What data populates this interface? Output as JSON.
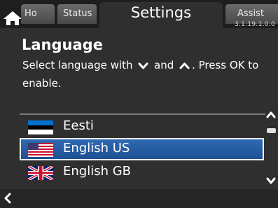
{
  "tabs": {
    "home": {
      "label": "Ho",
      "icon": "home-icon"
    },
    "status": {
      "label": "Status"
    },
    "settings": {
      "label": "Settings"
    },
    "assist": {
      "label": "Assist"
    }
  },
  "version": "3.1.19.1.0.0",
  "page": {
    "heading": "Language",
    "instruction_part1": "Select language with",
    "instruction_down_icon": "chevron-down-icon",
    "instruction_part2": "and",
    "instruction_up_icon": "chevron-up-icon",
    "instruction_part3": ". Press OK to enable."
  },
  "languages": [
    {
      "label": "Eesti",
      "flag": "estonia-flag-icon",
      "selected": false
    },
    {
      "label": "English US",
      "flag": "usa-flag-icon",
      "selected": true
    },
    {
      "label": "English GB",
      "flag": "uk-flag-icon",
      "selected": false
    }
  ],
  "scrollbar": {
    "up_icon": "chevron-up-icon",
    "down_icon": "chevron-down-icon"
  },
  "bottom": {
    "back_icon": "chevron-left-icon"
  },
  "colors": {
    "background": "#2f2f2f",
    "tabbar": "#1e1e1e",
    "selection": "#2f6ab3",
    "text": "#ffffff"
  }
}
